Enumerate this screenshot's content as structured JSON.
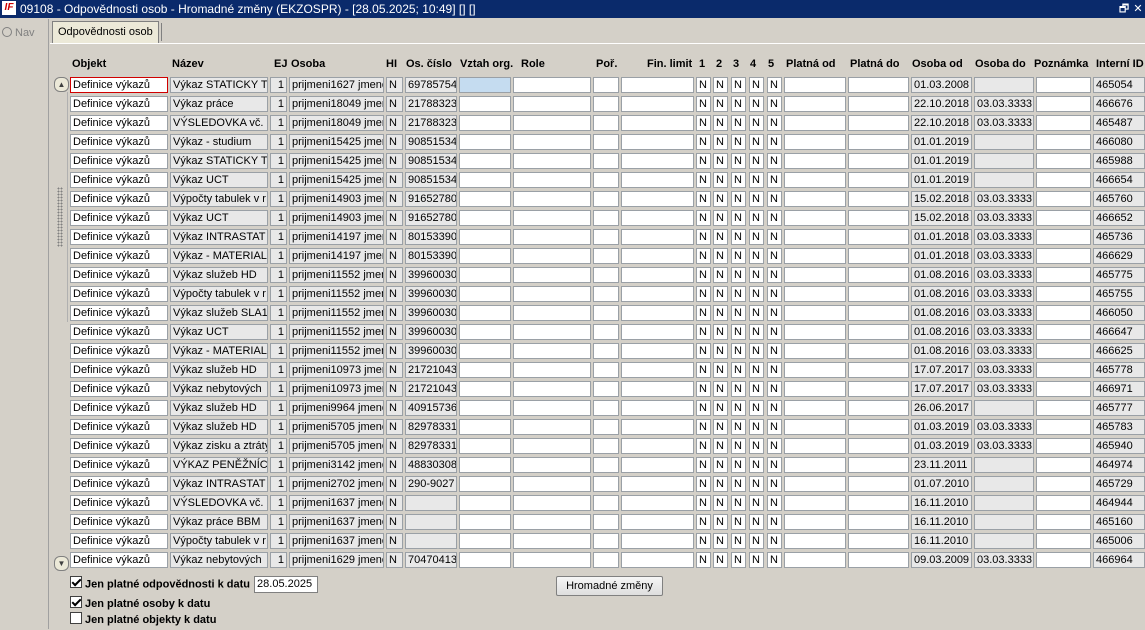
{
  "window": {
    "title": "09108 - Odpovědnosti osob - Hromadné změny (EKZOSPR) - [28.05.2025; 10:49]  []  []",
    "restore_glyph": "🗗",
    "close_glyph": "✕"
  },
  "nav": {
    "label": "Nav"
  },
  "tab": {
    "label": "Odpovědnosti osob"
  },
  "columns": [
    "Objekt",
    "Název",
    "EJ",
    "Osoba",
    "HI",
    "Os. číslo",
    "Vztah org.",
    "Role",
    "Poř.",
    "Fin. limit",
    "1",
    "2",
    "3",
    "4",
    "5",
    "Platná od",
    "Platná do",
    "Osoba od",
    "Osoba do",
    "Poznámka",
    "Interní ID"
  ],
  "rows": [
    {
      "objekt": "Definice výkazů",
      "nazev": "Výkaz STATICKY T",
      "ej": "1",
      "osoba": "prijmeni1627 jmeno",
      "hi": "N",
      "oscislo": "69785754",
      "c1": "N",
      "c2": "N",
      "c3": "N",
      "c4": "N",
      "c5": "N",
      "osobaod": "01.03.2008",
      "osobado": "",
      "id": "465054"
    },
    {
      "objekt": "Definice výkazů",
      "nazev": "Výkaz práce",
      "ej": "1",
      "osoba": "prijmeni18049 jmen",
      "hi": "N",
      "oscislo": "21788323",
      "c1": "N",
      "c2": "N",
      "c3": "N",
      "c4": "N",
      "c5": "N",
      "osobaod": "22.10.2018",
      "osobado": "03.03.3333",
      "id": "466676"
    },
    {
      "objekt": "Definice výkazů",
      "nazev": "VÝSLEDOVKA vč.",
      "ej": "1",
      "osoba": "prijmeni18049 jmen",
      "hi": "N",
      "oscislo": "21788323",
      "c1": "N",
      "c2": "N",
      "c3": "N",
      "c4": "N",
      "c5": "N",
      "osobaod": "22.10.2018",
      "osobado": "03.03.3333",
      "id": "465487"
    },
    {
      "objekt": "Definice výkazů",
      "nazev": "Výkaz - studium",
      "ej": "1",
      "osoba": "prijmeni15425 jmen",
      "hi": "N",
      "oscislo": "90851534",
      "c1": "N",
      "c2": "N",
      "c3": "N",
      "c4": "N",
      "c5": "N",
      "osobaod": "01.01.2019",
      "osobado": "",
      "id": "466080"
    },
    {
      "objekt": "Definice výkazů",
      "nazev": "Výkaz STATICKY T",
      "ej": "1",
      "osoba": "prijmeni15425 jmen",
      "hi": "N",
      "oscislo": "90851534",
      "c1": "N",
      "c2": "N",
      "c3": "N",
      "c4": "N",
      "c5": "N",
      "osobaod": "01.01.2019",
      "osobado": "",
      "id": "465988"
    },
    {
      "objekt": "Definice výkazů",
      "nazev": "Výkaz UCT",
      "ej": "1",
      "osoba": "prijmeni15425 jmen",
      "hi": "N",
      "oscislo": "90851534",
      "c1": "N",
      "c2": "N",
      "c3": "N",
      "c4": "N",
      "c5": "N",
      "osobaod": "01.01.2019",
      "osobado": "",
      "id": "466654"
    },
    {
      "objekt": "Definice výkazů",
      "nazev": "Výpočty tabulek v r",
      "ej": "1",
      "osoba": "prijmeni14903 jmen",
      "hi": "N",
      "oscislo": "91652780",
      "c1": "N",
      "c2": "N",
      "c3": "N",
      "c4": "N",
      "c5": "N",
      "osobaod": "15.02.2018",
      "osobado": "03.03.3333",
      "id": "465760"
    },
    {
      "objekt": "Definice výkazů",
      "nazev": "Výkaz UCT",
      "ej": "1",
      "osoba": "prijmeni14903 jmen",
      "hi": "N",
      "oscislo": "91652780",
      "c1": "N",
      "c2": "N",
      "c3": "N",
      "c4": "N",
      "c5": "N",
      "osobaod": "15.02.2018",
      "osobado": "03.03.3333",
      "id": "466652"
    },
    {
      "objekt": "Definice výkazů",
      "nazev": "Výkaz INTRASTAT",
      "ej": "1",
      "osoba": "prijmeni14197 jmen",
      "hi": "N",
      "oscislo": "80153390",
      "c1": "N",
      "c2": "N",
      "c3": "N",
      "c4": "N",
      "c5": "N",
      "osobaod": "01.01.2018",
      "osobado": "03.03.3333",
      "id": "465736"
    },
    {
      "objekt": "Definice výkazů",
      "nazev": "Výkaz - MATERIAL",
      "ej": "1",
      "osoba": "prijmeni14197 jmen",
      "hi": "N",
      "oscislo": "80153390",
      "c1": "N",
      "c2": "N",
      "c3": "N",
      "c4": "N",
      "c5": "N",
      "osobaod": "01.01.2018",
      "osobado": "03.03.3333",
      "id": "466629"
    },
    {
      "objekt": "Definice výkazů",
      "nazev": "Výkaz služeb HD",
      "ej": "1",
      "osoba": "prijmeni11552 jmen",
      "hi": "N",
      "oscislo": "39960030",
      "c1": "N",
      "c2": "N",
      "c3": "N",
      "c4": "N",
      "c5": "N",
      "osobaod": "01.08.2016",
      "osobado": "03.03.3333",
      "id": "465775"
    },
    {
      "objekt": "Definice výkazů",
      "nazev": "Výpočty tabulek v r",
      "ej": "1",
      "osoba": "prijmeni11552 jmen",
      "hi": "N",
      "oscislo": "39960030",
      "c1": "N",
      "c2": "N",
      "c3": "N",
      "c4": "N",
      "c5": "N",
      "osobaod": "01.08.2016",
      "osobado": "03.03.3333",
      "id": "465755"
    },
    {
      "objekt": "Definice výkazů",
      "nazev": "Výkaz služeb SLA1",
      "ej": "1",
      "osoba": "prijmeni11552 jmen",
      "hi": "N",
      "oscislo": "39960030",
      "c1": "N",
      "c2": "N",
      "c3": "N",
      "c4": "N",
      "c5": "N",
      "osobaod": "01.08.2016",
      "osobado": "03.03.3333",
      "id": "466050"
    },
    {
      "objekt": "Definice výkazů",
      "nazev": "Výkaz UCT",
      "ej": "1",
      "osoba": "prijmeni11552 jmen",
      "hi": "N",
      "oscislo": "39960030",
      "c1": "N",
      "c2": "N",
      "c3": "N",
      "c4": "N",
      "c5": "N",
      "osobaod": "01.08.2016",
      "osobado": "03.03.3333",
      "id": "466647"
    },
    {
      "objekt": "Definice výkazů",
      "nazev": "Výkaz - MATERIAL",
      "ej": "1",
      "osoba": "prijmeni11552 jmen",
      "hi": "N",
      "oscislo": "39960030",
      "c1": "N",
      "c2": "N",
      "c3": "N",
      "c4": "N",
      "c5": "N",
      "osobaod": "01.08.2016",
      "osobado": "03.03.3333",
      "id": "466625"
    },
    {
      "objekt": "Definice výkazů",
      "nazev": "Výkaz služeb HD",
      "ej": "1",
      "osoba": "prijmeni10973 jmen",
      "hi": "N",
      "oscislo": "21721043",
      "c1": "N",
      "c2": "N",
      "c3": "N",
      "c4": "N",
      "c5": "N",
      "osobaod": "17.07.2017",
      "osobado": "03.03.3333",
      "id": "465778"
    },
    {
      "objekt": "Definice výkazů",
      "nazev": "Výkaz nebytových",
      "ej": "1",
      "osoba": "prijmeni10973 jmen",
      "hi": "N",
      "oscislo": "21721043",
      "c1": "N",
      "c2": "N",
      "c3": "N",
      "c4": "N",
      "c5": "N",
      "osobaod": "17.07.2017",
      "osobado": "03.03.3333",
      "id": "466971"
    },
    {
      "objekt": "Definice výkazů",
      "nazev": "Výkaz služeb HD",
      "ej": "1",
      "osoba": "prijmeni9964 jmeno",
      "hi": "N",
      "oscislo": "40915736",
      "c1": "N",
      "c2": "N",
      "c3": "N",
      "c4": "N",
      "c5": "N",
      "osobaod": "26.06.2017",
      "osobado": "",
      "id": "465777"
    },
    {
      "objekt": "Definice výkazů",
      "nazev": "Výkaz služeb HD",
      "ej": "1",
      "osoba": "prijmeni5705 jmeno",
      "hi": "N",
      "oscislo": "82978331",
      "c1": "N",
      "c2": "N",
      "c3": "N",
      "c4": "N",
      "c5": "N",
      "osobaod": "01.03.2019",
      "osobado": "03.03.3333",
      "id": "465783"
    },
    {
      "objekt": "Definice výkazů",
      "nazev": "Výkaz zisku a ztráty",
      "ej": "1",
      "osoba": "prijmeni5705 jmeno",
      "hi": "N",
      "oscislo": "82978331",
      "c1": "N",
      "c2": "N",
      "c3": "N",
      "c4": "N",
      "c5": "N",
      "osobaod": "01.03.2019",
      "osobado": "03.03.3333",
      "id": "465940"
    },
    {
      "objekt": "Definice výkazů",
      "nazev": "VÝKAZ PENĚŽNÍCH",
      "ej": "1",
      "osoba": "prijmeni3142 jmeno",
      "hi": "N",
      "oscislo": "48830308",
      "c1": "N",
      "c2": "N",
      "c3": "N",
      "c4": "N",
      "c5": "N",
      "osobaod": "23.11.2011",
      "osobado": "",
      "id": "464974"
    },
    {
      "objekt": "Definice výkazů",
      "nazev": "Výkaz INTRASTAT",
      "ej": "1",
      "osoba": "prijmeni2702 jmeno",
      "hi": "N",
      "oscislo": "290-9027",
      "c1": "N",
      "c2": "N",
      "c3": "N",
      "c4": "N",
      "c5": "N",
      "osobaod": "01.07.2010",
      "osobado": "",
      "id": "465729"
    },
    {
      "objekt": "Definice výkazů",
      "nazev": "VÝSLEDOVKA vč.",
      "ej": "1",
      "osoba": "prijmeni1637 jmeno",
      "hi": "N",
      "oscislo": "",
      "c1": "N",
      "c2": "N",
      "c3": "N",
      "c4": "N",
      "c5": "N",
      "osobaod": "16.11.2010",
      "osobado": "",
      "id": "464944"
    },
    {
      "objekt": "Definice výkazů",
      "nazev": "Výkaz práce BBM",
      "ej": "1",
      "osoba": "prijmeni1637 jmeno",
      "hi": "N",
      "oscislo": "",
      "c1": "N",
      "c2": "N",
      "c3": "N",
      "c4": "N",
      "c5": "N",
      "osobaod": "16.11.2010",
      "osobado": "",
      "id": "465160"
    },
    {
      "objekt": "Definice výkazů",
      "nazev": "Výpočty tabulek v r",
      "ej": "1",
      "osoba": "prijmeni1637 jmeno",
      "hi": "N",
      "oscislo": "",
      "c1": "N",
      "c2": "N",
      "c3": "N",
      "c4": "N",
      "c5": "N",
      "osobaod": "16.11.2010",
      "osobado": "",
      "id": "465006"
    },
    {
      "objekt": "Definice výkazů",
      "nazev": "Výkaz nebytových",
      "ej": "1",
      "osoba": "prijmeni1629 jmeno",
      "hi": "N",
      "oscislo": "70470413",
      "c1": "N",
      "c2": "N",
      "c3": "N",
      "c4": "N",
      "c5": "N",
      "osobaod": "09.03.2009",
      "osobado": "03.03.3333",
      "id": "466964"
    }
  ],
  "filters": {
    "platne_odpovednosti": {
      "label": "Jen platné odpovědnosti k datu",
      "checked": true,
      "date": "28.05.2025"
    },
    "platne_osoby": {
      "label": "Jen platné osoby k datu",
      "checked": true
    },
    "platne_objekty": {
      "label": "Jen platné objekty k datu",
      "checked": false
    }
  },
  "buttons": {
    "hromadne_zmeny": "Hromadné změny"
  },
  "colors": {
    "title_bar": "#0a2a6b",
    "selected_cell": "#c5dcf0",
    "focus_border": "#d00000"
  }
}
